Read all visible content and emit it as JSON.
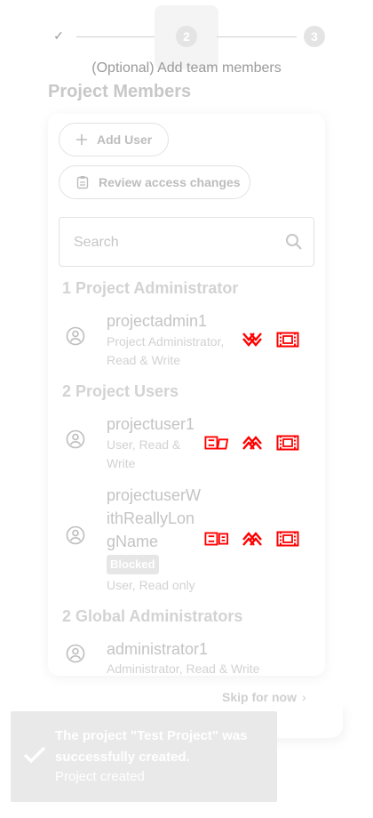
{
  "stepper": {
    "step2_number": "2",
    "step3_number": "3",
    "caption": "(Optional) Add team members"
  },
  "page_title": "Project Members",
  "actions": {
    "add_user": "Add User",
    "review_access": "Review access changes"
  },
  "search": {
    "placeholder": "Search"
  },
  "sections": {
    "admins": "1 Project Administrator",
    "users": "2 Project Users",
    "global": "2 Global Administrators"
  },
  "members": [
    {
      "name": "projectadmin1",
      "role_line1": "Project Administrator,",
      "role_line2": "Read & Write"
    },
    {
      "name": "projectuser1",
      "role_line1": "User, Read &",
      "role_line2": "Write"
    },
    {
      "name_line1": "projectuserW",
      "name_line2": "ithReallyLon",
      "name_line3": "gName",
      "badge": "Blocked",
      "role": "User, Read only"
    },
    {
      "name": "administrator1",
      "role": "Administrator, Read & Write"
    }
  ],
  "skip": {
    "label": "Skip for now"
  },
  "toast": {
    "message_line1": "The project \"Test Project\" was",
    "message_line2": "successfully created.",
    "subtitle": "Project created"
  },
  "colors": {
    "action_icon": "#ff0000",
    "toast_bg": "#e9e9e9"
  }
}
